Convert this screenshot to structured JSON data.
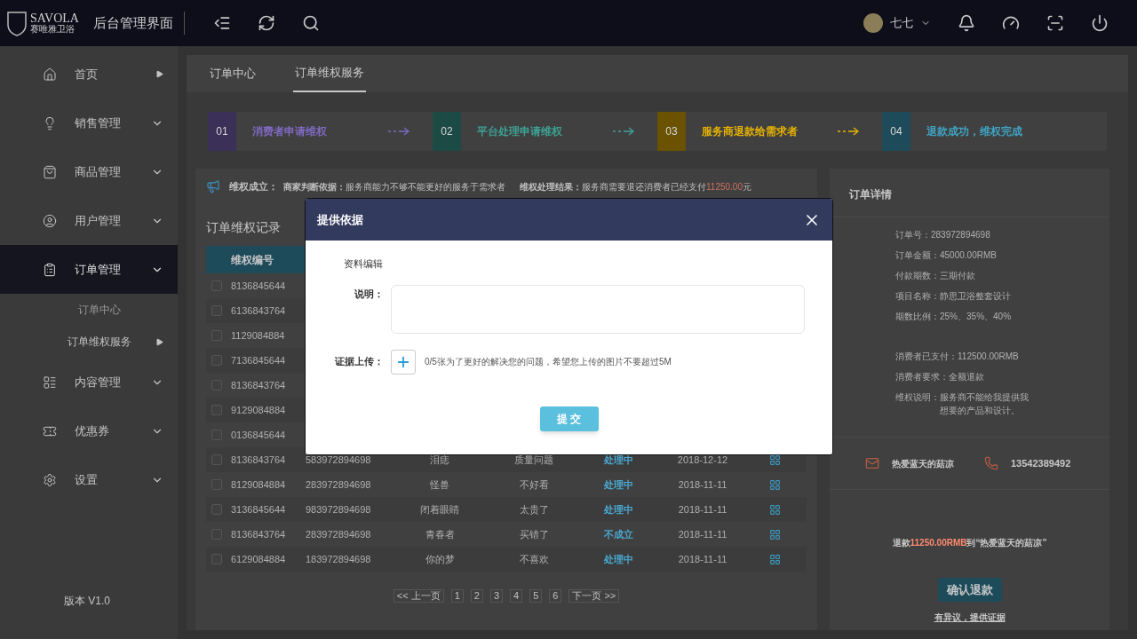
{
  "header": {
    "logo_text": "SAVOLA",
    "logo_sub": "赛唯雅卫浴",
    "title": "后台管理界面",
    "user": "七七"
  },
  "sidebar": {
    "items": [
      {
        "label": "首页",
        "selected": false,
        "kind": "link"
      },
      {
        "label": "销售管理",
        "selected": false,
        "kind": "menu"
      },
      {
        "label": "商品管理",
        "selected": false,
        "kind": "menu"
      },
      {
        "label": "用户管理",
        "selected": false,
        "kind": "menu"
      },
      {
        "label": "订单管理",
        "selected": true,
        "kind": "menu",
        "children": [
          {
            "label": "订单中心",
            "selected": false
          },
          {
            "label": "订单维权服务",
            "selected": true
          }
        ]
      },
      {
        "label": "内容管理",
        "selected": false,
        "kind": "menu"
      },
      {
        "label": "优惠券",
        "selected": false,
        "kind": "menu"
      },
      {
        "label": "设置",
        "selected": false,
        "kind": "menu"
      }
    ],
    "version": "版本 V1.0"
  },
  "tabs": [
    {
      "label": "订单中心",
      "selected": false
    },
    {
      "label": "订单维权服务",
      "selected": true
    }
  ],
  "steps": [
    {
      "number": "01",
      "label": "消费者申请维权",
      "color": "#3a3058"
    },
    {
      "number": "02",
      "label": "平台处理申请维权",
      "color": "#1c4a44"
    },
    {
      "number": "03",
      "label": "服务商退款给需求者",
      "color": "#6a5200"
    },
    {
      "number": "04",
      "label": "退款成功，维权完成",
      "color": "#1d4b5a"
    }
  ],
  "notice": {
    "title": "维权成立：",
    "basis_label": "商家判断依据：",
    "basis": "服务商能力不够不能更好的服务于需求者",
    "result_label": "维权处理结果：",
    "result": "服务商需要退还消费者已经支付",
    "amount": "11250.00",
    "unit": "元"
  },
  "records": {
    "title": "订单维权记录",
    "columns": [
      "维权编号"
    ],
    "rows": [
      {
        "checked": false,
        "cells": [
          "8136845644"
        ]
      },
      {
        "checked": false,
        "cells": [
          "6136843764"
        ]
      },
      {
        "checked": false,
        "cells": [
          "1129084884"
        ]
      },
      {
        "checked": false,
        "cells": [
          "7136845644"
        ]
      },
      {
        "checked": false,
        "cells": [
          "8136843764"
        ]
      },
      {
        "checked": false,
        "cells": [
          "9129084884"
        ]
      },
      {
        "checked": false,
        "cells": [
          "0136845644"
        ]
      },
      {
        "checked": false,
        "cells": [
          "8136843764",
          "583972894698",
          "泪痣",
          "质量问题",
          "处理中",
          "2018-12-12"
        ]
      },
      {
        "checked": false,
        "cells": [
          "8129084884",
          "283972894698",
          "怪兽",
          "不好看",
          "处理中",
          "2018-11-11"
        ]
      },
      {
        "checked": false,
        "cells": [
          "3136845644",
          "983972894698",
          "闭着眼睛",
          "太贵了",
          "处理中",
          "2018-11-11"
        ]
      },
      {
        "checked": false,
        "cells": [
          "8136843764",
          "283972894698",
          "青春者",
          "买错了",
          "不成立",
          "2018-11-11"
        ]
      },
      {
        "checked": false,
        "cells": [
          "6129084884",
          "183972894698",
          "你的梦",
          "不喜欢",
          "处理中",
          "2018-11-11"
        ]
      }
    ],
    "pagination": [
      "<< 上一页",
      "1",
      "2",
      "3",
      "4",
      "5",
      "6",
      "下一页 >>"
    ]
  },
  "details": {
    "title": "订单详情",
    "lines": [
      "订单号：283972894698",
      "订单金额：45000.00RMB",
      "付款期数：三期付款",
      "项目名称：静思卫浴整套设计",
      "期数比例：25%、35%、40%"
    ],
    "lines2": [
      "消费者已支付：112500.00RMB",
      "消费者要求：全额退款"
    ],
    "note_label": "维权说明：",
    "note": "服务商不能给我提供我想要的产品和设计。",
    "contact_name": "热爱蓝天的菇凉",
    "contact_phone": "13542389492",
    "refund_prefix": "退款",
    "refund_amount": "11250.00RMB",
    "refund_suffix": "到“热爱蓝天的菇凉”",
    "confirm": "确认退款",
    "dispute": "有异议，提供证据"
  },
  "modal": {
    "title": "提供依据",
    "section": "资料编辑",
    "desc_label": "说明：",
    "upload_label": "证据上传：",
    "upload_hint": "0/5张为了更好的解决您的问题，希望您上传的图片不要超过5M",
    "submit": "提 交"
  }
}
